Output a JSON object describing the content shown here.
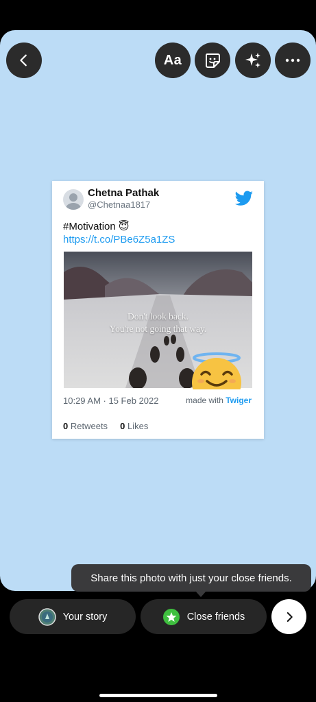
{
  "topbar": {
    "back_icon": "chevron-left-icon",
    "text_tool_label": "Aa",
    "sticker_icon": "sticker-icon",
    "effects_icon": "sparkles-icon",
    "more_icon": "more-horizontal-icon"
  },
  "tweet": {
    "name": "Chetna Pathak",
    "handle": "@Chetnaa1817",
    "text": "#Motivation 😇",
    "link": "https://t.co/PBe6Z5a1ZS",
    "image_quote_line1": "Don't look back.",
    "image_quote_line2": "You're not going that way.",
    "timestamp": "10:29 AM · 15 Feb 2022",
    "made_with_prefix": "made with",
    "made_with_app": "Twiger",
    "retweets_count": "0",
    "retweets_label": "Retweets",
    "likes_count": "0",
    "likes_label": "Likes"
  },
  "tooltip": {
    "text": "Share this photo with just your close friends."
  },
  "bottombar": {
    "your_story_label": "Your story",
    "close_friends_label": "Close friends",
    "next_icon": "chevron-right-icon"
  },
  "colors": {
    "canvas_bg": "#bcdcf6",
    "twitter_blue": "#1d9bf0",
    "close_friends_green": "#3fbf3f",
    "pill_bg": "#262626"
  }
}
